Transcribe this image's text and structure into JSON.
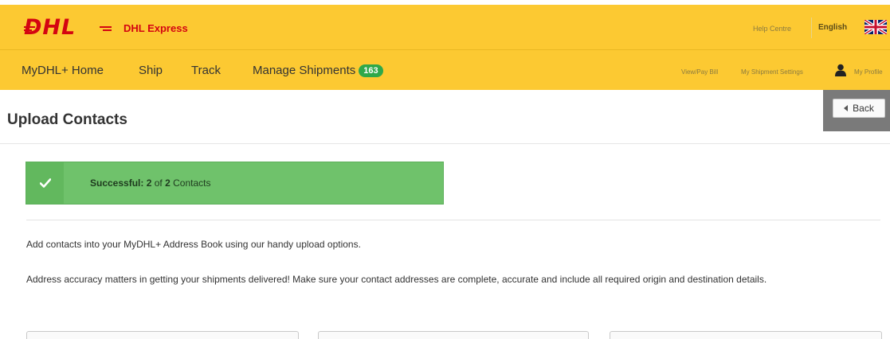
{
  "brand": {
    "title": "DHL Express",
    "logo_text": "DHL"
  },
  "top_links": {
    "help": "Help Centre",
    "language": "English"
  },
  "nav": {
    "items": [
      {
        "label": "MyDHL+ Home"
      },
      {
        "label": "Ship"
      },
      {
        "label": "Track"
      },
      {
        "label": "Manage Shipments",
        "badge": "163"
      }
    ],
    "utility": [
      {
        "label": "View/Pay Bill"
      },
      {
        "label": "My Shipment Settings"
      },
      {
        "label": "My Profile"
      }
    ]
  },
  "page": {
    "title": "Upload Contacts",
    "back_label": "Back"
  },
  "success": {
    "prefix": "Successful:",
    "count": "2",
    "of": "of",
    "total": "2",
    "suffix": "Contacts"
  },
  "content": {
    "intro": "Add contacts into your MyDHL+ Address Book using our handy upload options.",
    "accuracy": "Address accuracy matters in getting your shipments delivered! Make sure your contact addresses are complete, accurate and include all required origin and destination details."
  },
  "colors": {
    "brand_yellow": "#fcc932",
    "brand_red": "#d40511",
    "success_green": "#6fc26b",
    "badge_green": "#2ea84a"
  },
  "icons": {
    "success": "check-icon",
    "back": "chevron-left-icon",
    "profile": "user-icon",
    "language": "uk-flag-icon"
  }
}
